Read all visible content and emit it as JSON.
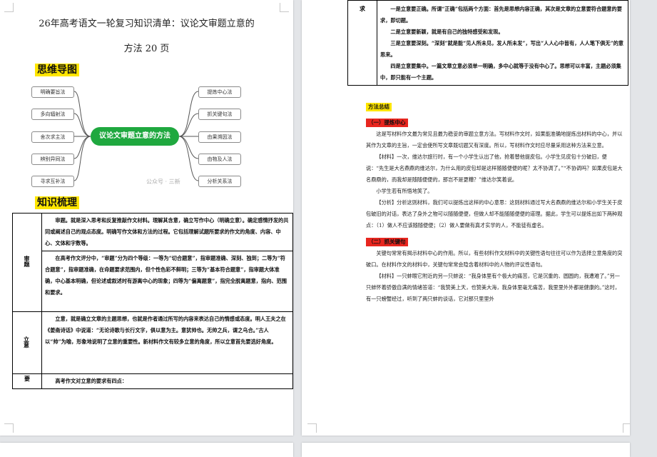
{
  "left_page": {
    "title_line1": "26年高考语文一轮复习知识清单：议论文审题立意的",
    "title_line2": "方法 20 页",
    "mindmap_heading": "思维导图",
    "mindmap": {
      "center": "议论文审题立意的方法",
      "left_nodes": [
        "明确要旨法",
        "多向辐射法",
        "舍次求主法",
        "辨别异同法",
        "寻求互补法"
      ],
      "right_nodes": [
        "提炼中心法",
        "抓关键句法",
        "由果溯因法",
        "由物及人法",
        "分析关系法"
      ]
    },
    "watermark": "公众号 · 三新",
    "knowledge_heading": "知识梳理",
    "table": [
      {
        "label": "审题",
        "paras": [
          "审题。就是深入思考和反复推敲作文材料。理解其含意，确立写作中心（明确立意）。确定感情抒发的共同或阐述自己的观点态度。明确写作文体和方法的过程。它包括理解试题所要求的作文的角度、内容、中心、文体和字数等。",
          "在高考作文评分中，“审题”分为四个等级：一等为“切合题意”，指审题准确、深刻、独到；二等为“符合题意”，指审题准确，在命题要求范围内，但个性色彩不鲜明；三等为“基本符合题意”，指审题大体准确，中心基本明确，但论述或叙述时有游离中心的现象；四等为“偏离题意”，指完全脱离题意，指向、范围和要求。"
        ]
      },
      {
        "label": "立意",
        "paras": [
          "立意，就是确立文章的主题思想，也就是作者通过所写的内容来表达自己的情感或态度。明人王夫之在《姜斋诗话》中说道：“无论诗歌与长行文字，俱以意为主。意犹帅也。无帅之兵，谓之乌合。”古人以“帅”为喻，形象地说明了立意的重要性。新材料作文有较多立意的角度，所以立意首先要选好角度。"
        ]
      },
      {
        "label": "要",
        "paras": [
          "高考作文对立意的要求有四点："
        ]
      }
    ]
  },
  "right_page": {
    "table_label": "求",
    "table_paras": [
      "一是立意要正确。所谓“正确”包括两个方面：首先是思想内容正确，其次是文章的立意要符合题意的要求，即切题。",
      "二是立意要新颖，就是有自己的独特感受和发现。",
      "三是立意要深刻。“深刻”就是能“见人所未见，发人所未发”，写出“人人心中皆有，人人笔下俱无”的意思来。",
      "四是立意要集中。一篇文章立意必须单一明确，多中心就等于没有中心了。思想可以丰富，主题必须集中，即只能有一个主题。"
    ],
    "methods_heading": "方法总结",
    "method1_tag": "（一）提炼中心",
    "method1_paras": [
      "这是写材料作文最为常见且最为稳妥的审题立意方法。写材料作文时，如果能准确地提炼出材料的中心，并以其作为文章的主旨，一定会使所写文章既切题又有深度。所以，写材料作文时应尽量采用这种方法来立意。",
      "【材料】一次，维达尔旅行时，有一个小学生认出了他，抢着替他提皮包。小学生见皮包十分破旧，便说：“先生是大名鼎鼎的维达尔，为什么用的皮包却是这样随随便便的呢？太不协调了。”“不协调吗？如果皮包是大名鼎鼎的，而我却是随随便便的，那岂不是更糟？”维达尔笑着说。",
      "小学生若有所悟地笑了。",
      "【分析】分析这则材料，我们可以提炼出这样的中心意思：这则材料通过写大名鼎鼎的维达尔和小学生关于皮包破旧的对话，表达了身外之物可以随随便便，但做人却不能随随便便的道理。据此，学生可以提炼出如下两种观点：（1）做人不应该随随便便；（2）做人要做有真才实学的人，不能徒有虚名。"
    ],
    "method2_tag": "（二）抓关键句",
    "method2_paras": [
      "关键句常常有揭示材料中心的作用。所以，有些材料作文材料中的关键性语句往往可以作为选择立意角度的突破口。在材料作文的材料中，关键句常常会隐含着材料中的人物的评议性语句。",
      "【材料】一只蚌眼它附近的另一只蚌说：“我身体里有个极大的痛苦，它是沉重的、圆圆的，我遭难了。”另一只蚌怀着骄傲自满的情绪答道：“我赞美上天，也赞美大海，我身体里毫无痛苦，我里里外外都是健康的。”这时，有一只螃蟹经过，听到了两只蚌的谈话，它对那只里里外"
    ]
  }
}
